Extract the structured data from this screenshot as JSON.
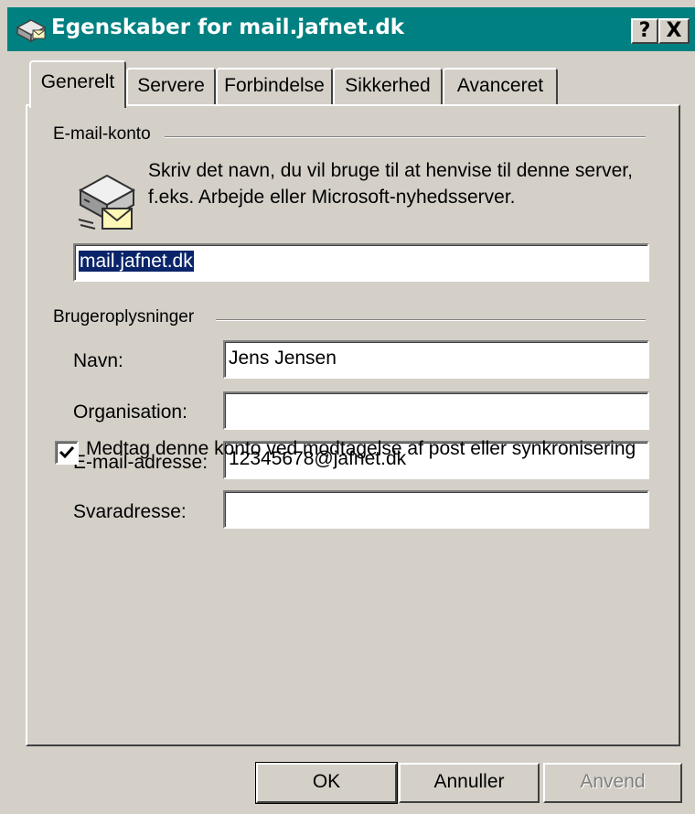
{
  "window": {
    "title": "Egenskaber for mail.jafnet.dk",
    "help_button": "?",
    "close_button": "X"
  },
  "tabs": [
    {
      "label": "Generelt",
      "active": true
    },
    {
      "label": "Servere",
      "active": false
    },
    {
      "label": "Forbindelse",
      "active": false
    },
    {
      "label": "Sikkerhed",
      "active": false
    },
    {
      "label": "Avanceret",
      "active": false
    }
  ],
  "email_account": {
    "group_label": "E-mail-konto",
    "description": "Skriv det navn, du vil bruge til at henvise til denne server, f.eks. Arbejde eller Microsoft-nyhedsserver.",
    "account_name_value": "mail.jafnet.dk",
    "icon": "mail-server-icon"
  },
  "user_info": {
    "group_label": "Brugeroplysninger",
    "name_label": "Navn:",
    "name_value": "Jens Jensen",
    "organization_label": "Organisation:",
    "organization_value": "",
    "email_label": "E-mail-adresse:",
    "email_value": "12345678@jafnet.dk",
    "reply_label": "Svaradresse:",
    "reply_value": ""
  },
  "include_account": {
    "checked": true,
    "label": "Medtag denne konto ved modtagelse af post eller synkronisering"
  },
  "buttons": {
    "ok": "OK",
    "cancel": "Annuller",
    "apply": "Anvend"
  },
  "colors": {
    "titlebar": "#008080",
    "face": "#d4d0c8",
    "selection": "#0a246a"
  }
}
